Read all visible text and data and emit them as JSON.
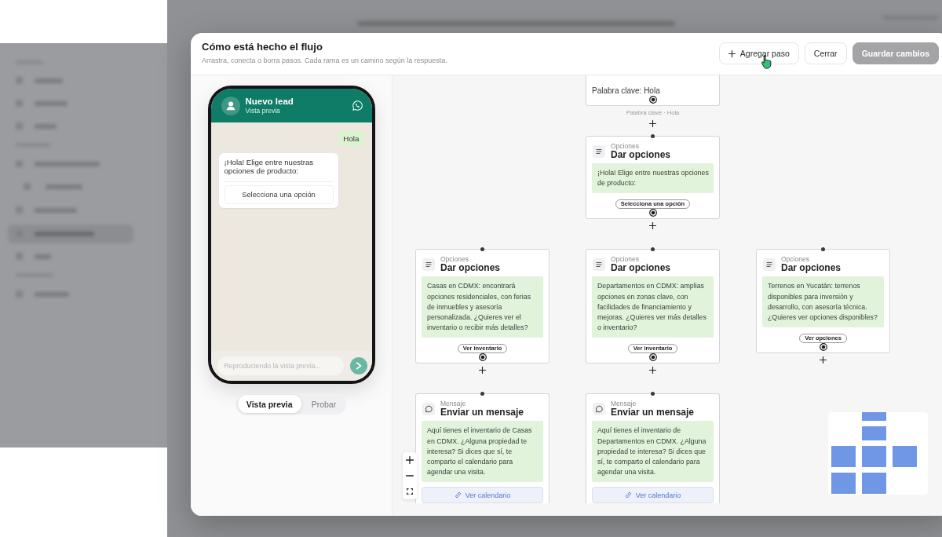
{
  "modal": {
    "title": "Cómo está hecho el flujo",
    "subtitle": "Arrastra, conecta o borra pasos. Cada rama es un camino según la respuesta.",
    "actions": [
      {
        "kind": "add",
        "label": "Agregar paso",
        "disabled": false
      },
      {
        "kind": "close",
        "label": "Cerrar",
        "disabled": false
      },
      {
        "kind": "save",
        "label": "Guardar cambios",
        "disabled": true
      }
    ]
  },
  "preview": {
    "contact": {
      "name": "Nuevo lead",
      "status": "Vista previa"
    },
    "messages": [
      {
        "kind": "outgoing",
        "text": "Hola"
      },
      {
        "kind": "incoming",
        "text": "¡Hola! Elige entre nuestras opciones de producto:",
        "button": "Selecciona una opción"
      }
    ],
    "composer": {
      "placeholder": "Reproduciendo la vista previa..."
    },
    "tabs": [
      {
        "label": "Vista previa",
        "selected": true
      },
      {
        "label": "Probar",
        "selected": false
      }
    ]
  },
  "flow": {
    "rows": [
      [
        {
          "kind": "trigger",
          "text": "Palabra clave: Hola",
          "edge_label": "Palabra clave · Hola"
        }
      ],
      [
        {
          "kind": "options",
          "type_label": "Opciones",
          "title": "Dar opciones",
          "text": "¡Hola! Elige entre nuestras opciones de producto:",
          "button": "Selecciona una opción"
        }
      ],
      [
        {
          "kind": "options",
          "type_label": "Opciones",
          "title": "Dar opciones",
          "text": "Casas en CDMX: encontrará opciones residenciales, con ferias de inmuebles y asesoría personalizada. ¿Quieres ver el inventario o recibir más detalles?",
          "button": "Ver inventario"
        },
        {
          "kind": "options",
          "type_label": "Opciones",
          "title": "Dar opciones",
          "text": "Departamentos en CDMX: amplias opciones en zonas clave, con facilidades de financiamiento y mejoras. ¿Quieres ver más detalles o inventario?",
          "button": "Ver inventario"
        },
        {
          "kind": "options",
          "type_label": "Opciones",
          "title": "Dar opciones",
          "text": "Terrenos en Yucatán: terrenos disponibles para inversión y desarrollo, con asesoría técnica. ¿Quieres ver opciones disponibles?",
          "button": "Ver opciones"
        }
      ],
      [
        {
          "kind": "message",
          "type_label": "Mensaje",
          "title": "Enviar un mensaje",
          "text": "Aquí tienes el inventario de Casas en CDMX. ¿Alguna propiedad te interesa? Si dices que sí, te comparto el calendario para agendar una visita.",
          "link": "Ver calendario"
        },
        {
          "kind": "message",
          "type_label": "Mensaje",
          "title": "Enviar un mensaje",
          "text": "Aquí tienes el inventario de Departamentos en CDMX. ¿Alguna propiedad te interesa? Si dices que sí, te comparto el calendario para agendar una visita.",
          "link": "Ver calendario"
        }
      ]
    ]
  }
}
